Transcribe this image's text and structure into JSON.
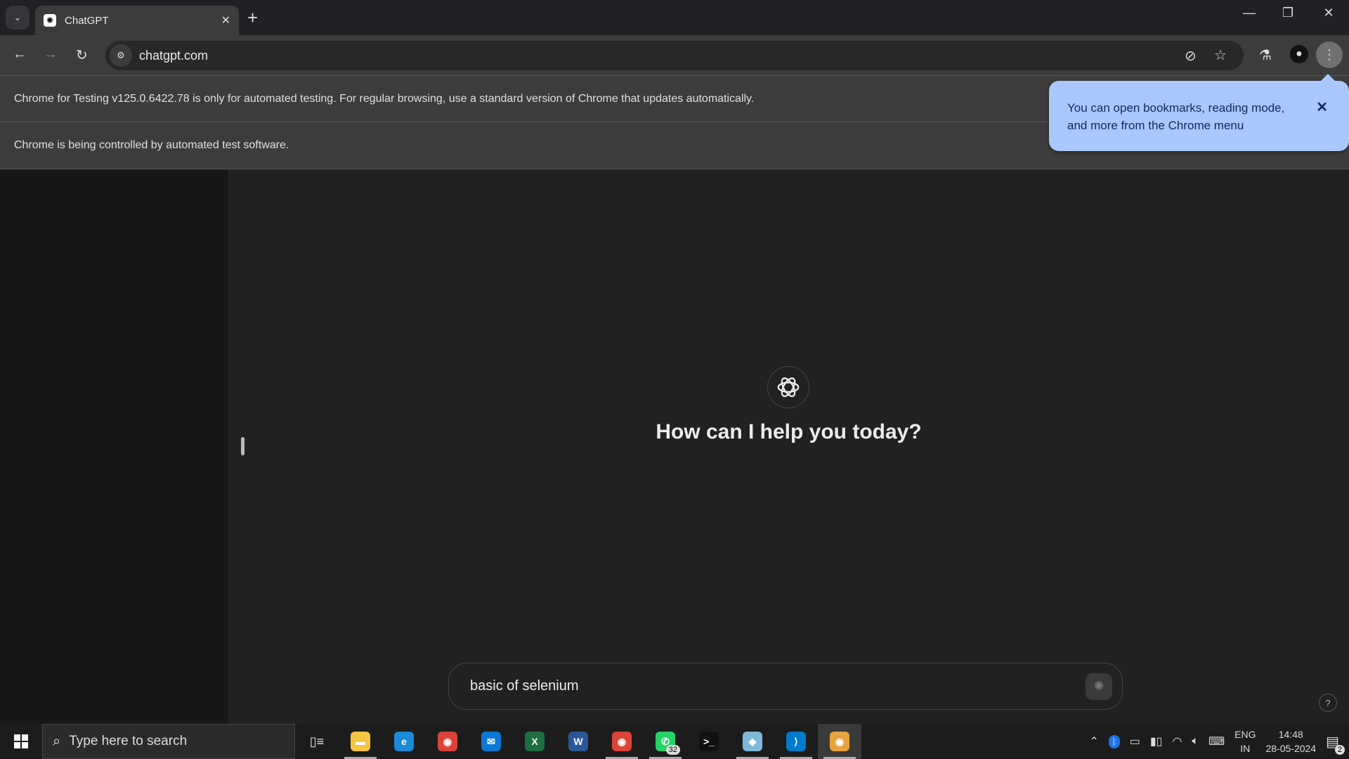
{
  "browser": {
    "tab_title": "ChatGPT",
    "url": "chatgpt.com",
    "infobar_testing": "Chrome for Testing v125.0.6422.78 is only for automated testing. For regular browsing, use a standard version of Chrome that updates automatically.",
    "infobar_controlled": "Chrome is being controlled by automated test software.",
    "bubble_text": "You can open bookmarks, reading mode, and more from the Chrome menu"
  },
  "main": {
    "heading": "How can I help you today?",
    "composer_value": "basic of selenium",
    "help": "?"
  },
  "taskbar": {
    "search_placeholder": "Type here to search",
    "whatsapp_badge": "32",
    "apps": [
      {
        "name": "file-explorer",
        "color": "#f4c542",
        "glyph": "▬"
      },
      {
        "name": "edge",
        "color": "#1b8ad8",
        "glyph": "e"
      },
      {
        "name": "chrome",
        "color": "#db4437",
        "glyph": "◉"
      },
      {
        "name": "mail",
        "color": "#0a78d4",
        "glyph": "✉"
      },
      {
        "name": "excel",
        "color": "#1d6f42",
        "glyph": "X"
      },
      {
        "name": "word",
        "color": "#2b579a",
        "glyph": "W"
      },
      {
        "name": "chrome-profile",
        "color": "#db4437",
        "glyph": "◉"
      },
      {
        "name": "whatsapp",
        "color": "#25d366",
        "glyph": "✆"
      },
      {
        "name": "terminal",
        "color": "#111111",
        "glyph": ">_"
      },
      {
        "name": "notes-app",
        "color": "#7fb8d8",
        "glyph": "◆"
      },
      {
        "name": "vscode",
        "color": "#007acc",
        "glyph": "⟩"
      },
      {
        "name": "chrome-for-testing",
        "color": "#e8a33d",
        "glyph": "◉"
      }
    ],
    "lang_top": "ENG",
    "lang_bottom": "IN",
    "time": "14:48",
    "date": "28-05-2024",
    "notifications": "2"
  },
  "colors": {
    "accent_bubble": "#a8c7fa",
    "sidebar": "#171717",
    "main": "#212121"
  }
}
